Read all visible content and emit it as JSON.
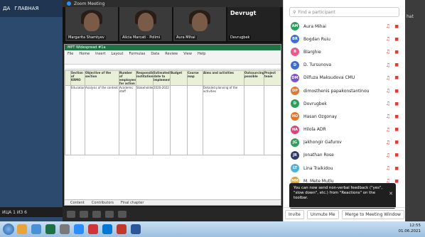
{
  "left": {
    "top_labels": [
      "ДА",
      "ГЛАВНАЯ"
    ],
    "bottom_text": "ИЦА 1 ИЗ 6"
  },
  "zoom": {
    "title": "Zoom Meeting",
    "videos": [
      {
        "name": "Margarita Shamtyev"
      },
      {
        "name": "Alicia Marcati · Polimi"
      },
      {
        "name": "Aura Mihai"
      },
      {
        "name": "Devrugbek",
        "big": "Devrugt"
      }
    ]
  },
  "excel": {
    "title": "MPT Widespread #1a",
    "menu": [
      "File",
      "Home",
      "Insert",
      "Layout",
      "Formulas",
      "Data",
      "Review",
      "View",
      "Help"
    ],
    "headers": [
      "Section of KRMO",
      "Objective of the section",
      "Number of employees for action",
      "Responsible institution",
      "Estimated date to implement",
      "Budget",
      "Course map",
      "Aims and activities",
      "Outsourcing possible",
      "Project team"
    ],
    "sample_row": [
      "Education",
      "Analysis of the context",
      "Academic staff",
      "Stakeholders",
      "2020-2022",
      "",
      "",
      "Detailed planning of the activities",
      "",
      ""
    ],
    "tabs": [
      "Content",
      "Contributors",
      "Final chapter"
    ]
  },
  "panel": {
    "search_placeholder": "Find a participant",
    "participants": [
      {
        "initials": "AM",
        "name": "Aura Mihai",
        "color": "#2d9e5b"
      },
      {
        "initials": "BR",
        "name": "Bogdan Ruiu",
        "color": "#3b6fd1"
      },
      {
        "initials": "B",
        "name": "Blarghie",
        "color": "#e85b8a"
      },
      {
        "initials": "D",
        "name": "D. Tursunova",
        "color": "#3b6fd1"
      },
      {
        "initials": "DM",
        "name": "Dilfuza Maksudova CMU",
        "color": "#7b57c6"
      },
      {
        "initials": "DP",
        "name": "dimosthenis papakonstantinou",
        "color": "#e2762c"
      },
      {
        "initials": "D",
        "name": "Dovrugbek",
        "color": "#2d9e5b"
      },
      {
        "initials": "HO",
        "name": "Hasan Ozgonay",
        "color": "#e2762c"
      },
      {
        "initials": "HA",
        "name": "Hilola ADR",
        "color": "#d7457d"
      },
      {
        "initials": "JG",
        "name": "Jakhongir Gafurov",
        "color": "#2d9e5b"
      },
      {
        "initials": "JR",
        "name": "Jonathan Rose",
        "color": "#333a6b"
      },
      {
        "initials": "LT",
        "name": "Lina Traikidou",
        "color": "#4fb3d9"
      },
      {
        "initials": "MM",
        "name": "M. Mete Mutlu",
        "color": "#e2a02c"
      }
    ],
    "tooltip": "You can now send non-verbal feedback (\"yes\", \"slow down\", etc.) from \"Reactions\" on the toolbar.",
    "footer": [
      "Invite",
      "Unmute Me",
      "Merge to Meeting Window"
    ],
    "right_label": "hat"
  },
  "taskbar": {
    "time": "12:55",
    "date": "01.06.2021"
  }
}
